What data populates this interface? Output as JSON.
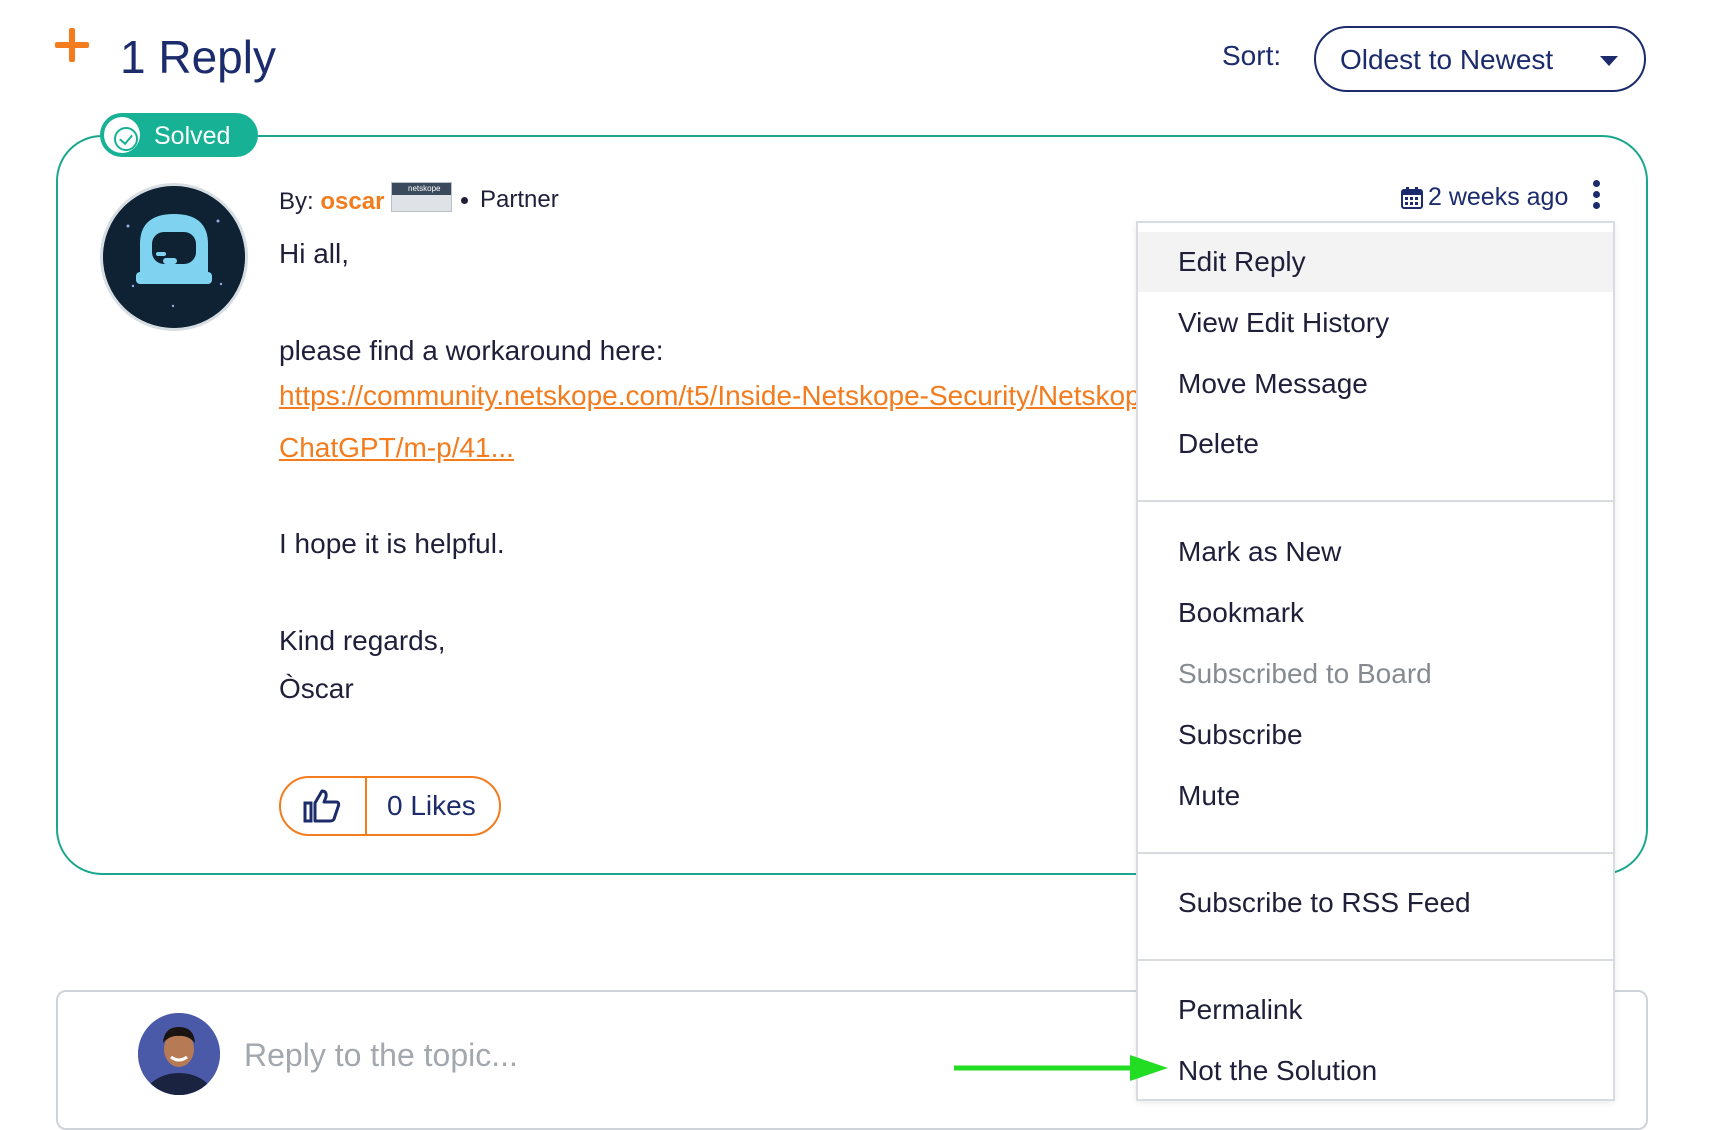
{
  "header": {
    "reply_count": "1 Reply",
    "sort_label": "Sort:",
    "sort_value": "Oldest to Newest"
  },
  "post": {
    "badge": "Solved",
    "by_label": "By:",
    "author": "oscar",
    "partner_logo_text": "netskope",
    "role": "Partner",
    "timestamp": "2 weeks ago",
    "body": {
      "greeting": "Hi all,",
      "intro": "please find a workaround here:",
      "link_line1": "https://community.netskope.com/t5/Inside-Netskope-Security/Netskope-",
      "link_line2": "ChatGPT/m-p/41...",
      "helpful": "I hope it is helpful.",
      "regards": "Kind regards,",
      "signature": "Òscar"
    },
    "likes_label": "0 Likes"
  },
  "menu": {
    "items": [
      {
        "label": "Edit Reply",
        "state": "highlighted"
      },
      {
        "label": "View Edit History"
      },
      {
        "label": "Move Message"
      },
      {
        "label": "Delete"
      },
      {
        "label": "Mark as New"
      },
      {
        "label": "Bookmark"
      },
      {
        "label": "Subscribed to Board",
        "state": "disabled"
      },
      {
        "label": "Subscribe"
      },
      {
        "label": "Mute"
      },
      {
        "label": "Subscribe to RSS Feed"
      },
      {
        "label": "Permalink"
      },
      {
        "label": "Not the Solution"
      }
    ]
  },
  "reply_box": {
    "placeholder": "Reply to the topic..."
  },
  "colors": {
    "accent_orange": "#f27c1e",
    "navy": "#1b2b6b",
    "solved_green": "#17b195",
    "annotation_arrow": "#22dd22"
  },
  "icons": {
    "add": "plus-icon",
    "sort": "caret-down-icon",
    "solved": "check-circle-icon",
    "date": "calendar-icon",
    "options": "kebab-icon",
    "like": "thumbs-up-icon"
  }
}
